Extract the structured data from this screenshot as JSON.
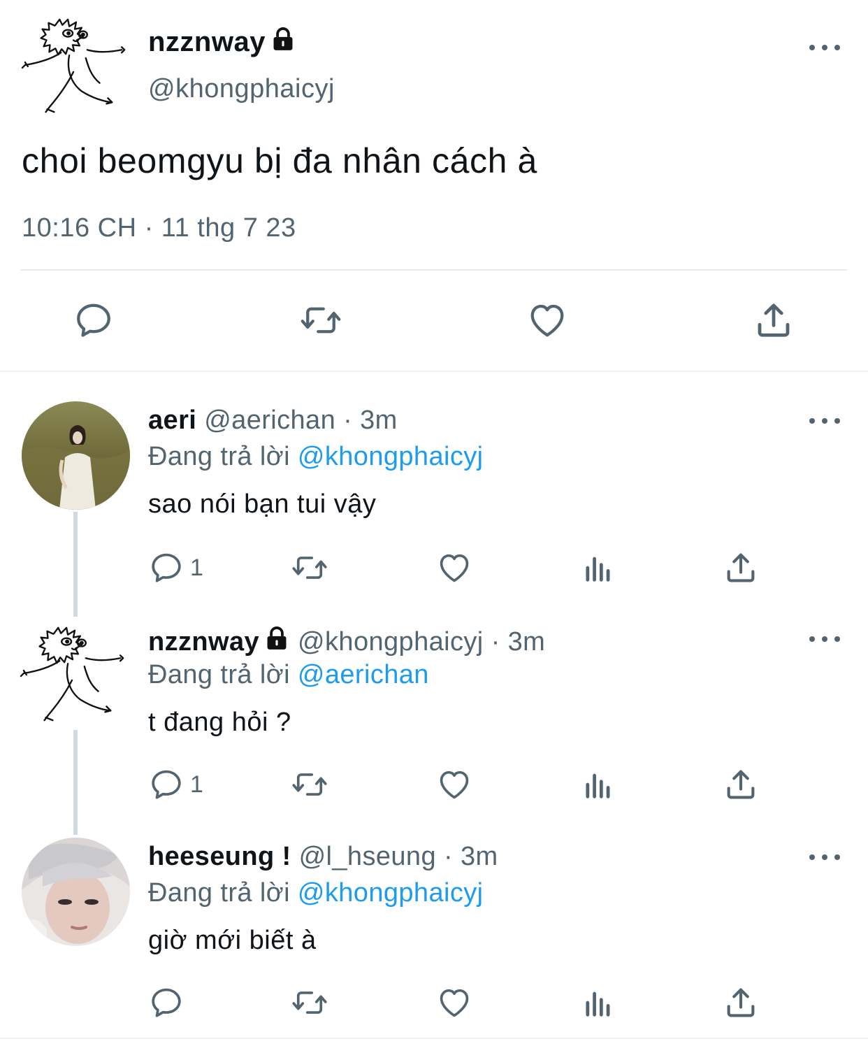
{
  "main_tweet": {
    "name": "nzznway",
    "handle": "@khongphaicyj",
    "text": "choi beomgyu bị đa nhân cách à",
    "timestamp": "10:16 CH · 11 thg 7 23"
  },
  "replies": [
    {
      "name": "aeri",
      "handle": "@aerichan",
      "dot": "·",
      "time": "3m",
      "replying_prefix": "Đang trả lời",
      "replying_to": "@khongphaicyj",
      "text": "sao nói bạn tui vậy",
      "reply_count": "1"
    },
    {
      "name": "nzznway",
      "handle": "@khongphaicyj",
      "dot": "·",
      "time": "3m",
      "replying_prefix": "Đang trả lời",
      "replying_to": "@aerichan",
      "text": "t đang hỏi ?",
      "reply_count": "1"
    },
    {
      "name": "heeseung !",
      "handle": "@l_hseung",
      "dot": "·",
      "time": "3m",
      "replying_prefix": "Đang trả lời",
      "replying_to": "@khongphaicyj",
      "text": "giờ mới biết à",
      "reply_count": ""
    }
  ],
  "colors": {
    "text_primary": "#0f1419",
    "text_secondary": "#536471",
    "link": "#1d9bf0",
    "divider": "#e7e9ea"
  },
  "icons": [
    "reply-icon",
    "retweet-icon",
    "like-icon",
    "share-icon",
    "views-icon",
    "more-icon",
    "lock-icon"
  ]
}
